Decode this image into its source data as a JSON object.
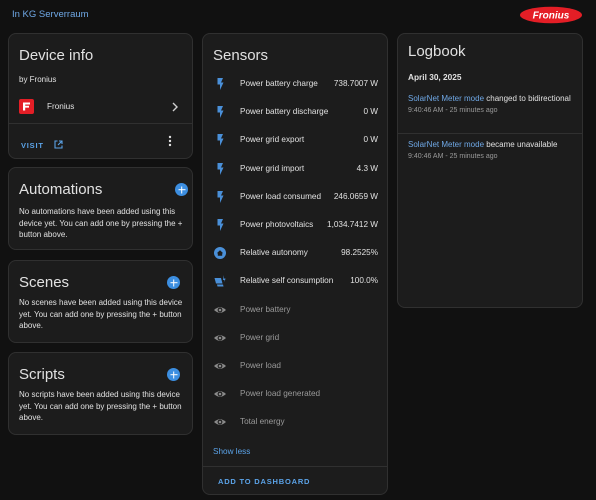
{
  "topbar": {
    "area_link": "In KG Serverraum",
    "logo_text": "Fronius",
    "logo_color": "#e41e26"
  },
  "device_info": {
    "title": "Device info",
    "manufacturer": "by Fronius",
    "integration_name": "Fronius",
    "visit_label": "VISIT"
  },
  "automations": {
    "title": "Automations",
    "text": "No automations have been added using this device yet. You can add one by pressing the + button above."
  },
  "scenes": {
    "title": "Scenes",
    "text": "No scenes have been added using this device yet. You can add one by pressing the + button above."
  },
  "scripts": {
    "title": "Scripts",
    "text": "No scripts have been added using this device yet. You can add one by pressing the + button above."
  },
  "sensors": {
    "title": "Sensors",
    "items": [
      {
        "name": "Power battery charge",
        "value": "738.7007 W",
        "icon": "flash-icon"
      },
      {
        "name": "Power battery discharge",
        "value": "0 W",
        "icon": "flash-icon"
      },
      {
        "name": "Power grid export",
        "value": "0 W",
        "icon": "flash-icon"
      },
      {
        "name": "Power grid import",
        "value": "4.3 W",
        "icon": "flash-icon"
      },
      {
        "name": "Power load consumed",
        "value": "246.0659 W",
        "icon": "flash-icon"
      },
      {
        "name": "Power photovoltaics",
        "value": "1,034.7412 W",
        "icon": "flash-icon"
      },
      {
        "name": "Relative autonomy",
        "value": "98.2525%",
        "icon": "home-circle-icon"
      },
      {
        "name": "Relative self consumption",
        "value": "100.0%",
        "icon": "solar-power-icon"
      },
      {
        "name": "Power battery",
        "value": "",
        "icon": "eye-icon"
      },
      {
        "name": "Power grid",
        "value": "",
        "icon": "eye-icon"
      },
      {
        "name": "Power load",
        "value": "",
        "icon": "eye-icon"
      },
      {
        "name": "Power load generated",
        "value": "",
        "icon": "eye-icon"
      },
      {
        "name": "Total energy",
        "value": "",
        "icon": "eye-icon"
      }
    ],
    "show_less": "Show less",
    "add_to_dashboard": "ADD TO DASHBOARD"
  },
  "logbook": {
    "title": "Logbook",
    "date": "April 30, 2025",
    "entries": [
      {
        "entity": "SolarNet Meter mode",
        "message": " changed to bidirectional",
        "time": "9:40:46 AM - 25 minutes ago"
      },
      {
        "entity": "SolarNet Meter mode",
        "message": " became unavailable",
        "time": "9:40:46 AM - 25 minutes ago"
      }
    ]
  },
  "colors": {
    "accent": "#3c8ee0",
    "link": "#6fa8e6",
    "icon_active": "#4a90d9",
    "icon_inactive": "#8a8a8a",
    "card_bg": "#1c1c1c",
    "page_bg": "#111111"
  }
}
